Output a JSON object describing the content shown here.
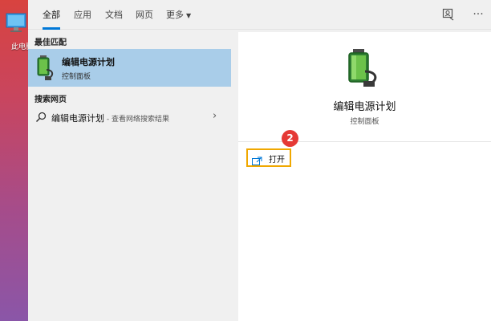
{
  "desktop": {
    "icon_label": "此电脑",
    "icon": "computer-icon"
  },
  "tabs": [
    {
      "label": "全部",
      "active": true
    },
    {
      "label": "应用"
    },
    {
      "label": "文档"
    },
    {
      "label": "网页"
    },
    {
      "label": "更多"
    }
  ],
  "toolbar": {
    "feedback_icon": "feedback-icon",
    "more_icon": "more-options-icon",
    "more_glyph": "···"
  },
  "results": {
    "best_match_header": "最佳匹配",
    "best_match": {
      "title": "编辑电源计划",
      "subtitle": "控制面板",
      "icon": "battery-plug-icon"
    },
    "web_header": "搜索网页",
    "web_item": {
      "title": "编辑电源计划",
      "hint": " - 查看网络搜索结果"
    }
  },
  "preview": {
    "title": "编辑电源计划",
    "subtitle": "控制面板",
    "open_label": "打开",
    "step_badge": "2"
  },
  "colors": {
    "accent": "#0078d7",
    "selected": "#a9cde9",
    "highlight_border": "#f0a800",
    "badge": "#e53935"
  }
}
